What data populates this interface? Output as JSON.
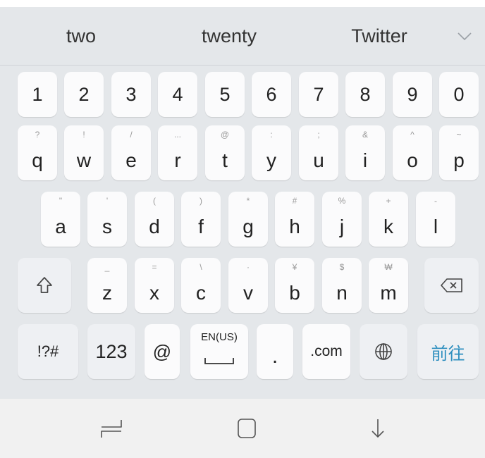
{
  "suggestions": [
    "two",
    "twenty",
    "Twitter"
  ],
  "numbers": [
    "1",
    "2",
    "3",
    "4",
    "5",
    "6",
    "7",
    "8",
    "9",
    "0"
  ],
  "row_q": [
    {
      "main": "q",
      "sub": "?"
    },
    {
      "main": "w",
      "sub": "!"
    },
    {
      "main": "e",
      "sub": "/"
    },
    {
      "main": "r",
      "sub": "..."
    },
    {
      "main": "t",
      "sub": "@"
    },
    {
      "main": "y",
      "sub": ":"
    },
    {
      "main": "u",
      "sub": ";"
    },
    {
      "main": "i",
      "sub": "&"
    },
    {
      "main": "o",
      "sub": "^"
    },
    {
      "main": "p",
      "sub": "~"
    }
  ],
  "row_a": [
    {
      "main": "a",
      "sub": "\""
    },
    {
      "main": "s",
      "sub": "'"
    },
    {
      "main": "d",
      "sub": "("
    },
    {
      "main": "f",
      "sub": ")"
    },
    {
      "main": "g",
      "sub": "*"
    },
    {
      "main": "h",
      "sub": "#"
    },
    {
      "main": "j",
      "sub": "%"
    },
    {
      "main": "k",
      "sub": "+"
    },
    {
      "main": "l",
      "sub": "-"
    }
  ],
  "row_z": [
    {
      "main": "z",
      "sub": "_"
    },
    {
      "main": "x",
      "sub": "="
    },
    {
      "main": "c",
      "sub": "\\"
    },
    {
      "main": "v",
      "sub": "·"
    },
    {
      "main": "b",
      "sub": "¥"
    },
    {
      "main": "n",
      "sub": "$"
    },
    {
      "main": "m",
      "sub": "₩"
    }
  ],
  "bottom": {
    "symbols": "!?#",
    "numeric": "123",
    "at": "@",
    "space_lang": "EN(US)",
    "period": ".",
    "dotcom": ".com",
    "go": "前往"
  },
  "icons": {
    "shift": "shift-icon",
    "backspace": "backspace-icon",
    "globe": "globe-icon",
    "chevron": "chevron-down-icon",
    "recents": "recent-apps-icon",
    "home": "home-icon",
    "back": "hide-keyboard-icon"
  },
  "colors": {
    "go_text": "#2f8fbf"
  }
}
